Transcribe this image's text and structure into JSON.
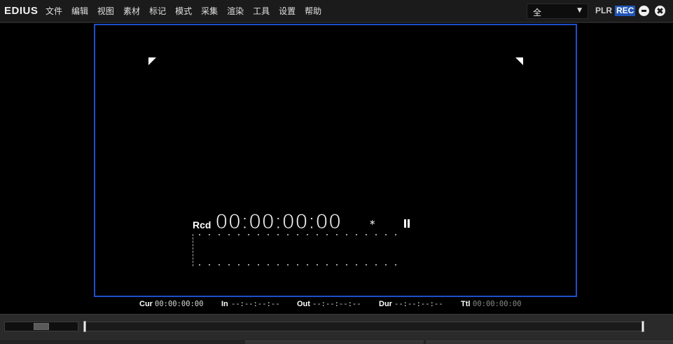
{
  "app": {
    "logo": "EDIUS",
    "menu": [
      "文件",
      "编辑",
      "视图",
      "素材",
      "标记",
      "模式",
      "采集",
      "渲染",
      "工具",
      "设置",
      "帮助"
    ],
    "mode_select": "全",
    "plr": "PLR",
    "rec": "REC"
  },
  "viewer": {
    "rcd_label": "Rcd",
    "timecode": "00:00:00:00",
    "timecode_mark": "*"
  },
  "timecodes": {
    "cur_label": "Cur",
    "cur_value": "00:00:00:00",
    "in_label": "In",
    "in_value": "--:--:--:--",
    "out_label": "Out",
    "out_value": "--:--:--:--",
    "dur_label": "Dur",
    "dur_value": "--:--:--:--",
    "ttl_label": "Ttl",
    "ttl_value": "00:00:00:00"
  },
  "colors": {
    "accent": "#1e4fc9",
    "rec_badge": "#1f55b6"
  }
}
